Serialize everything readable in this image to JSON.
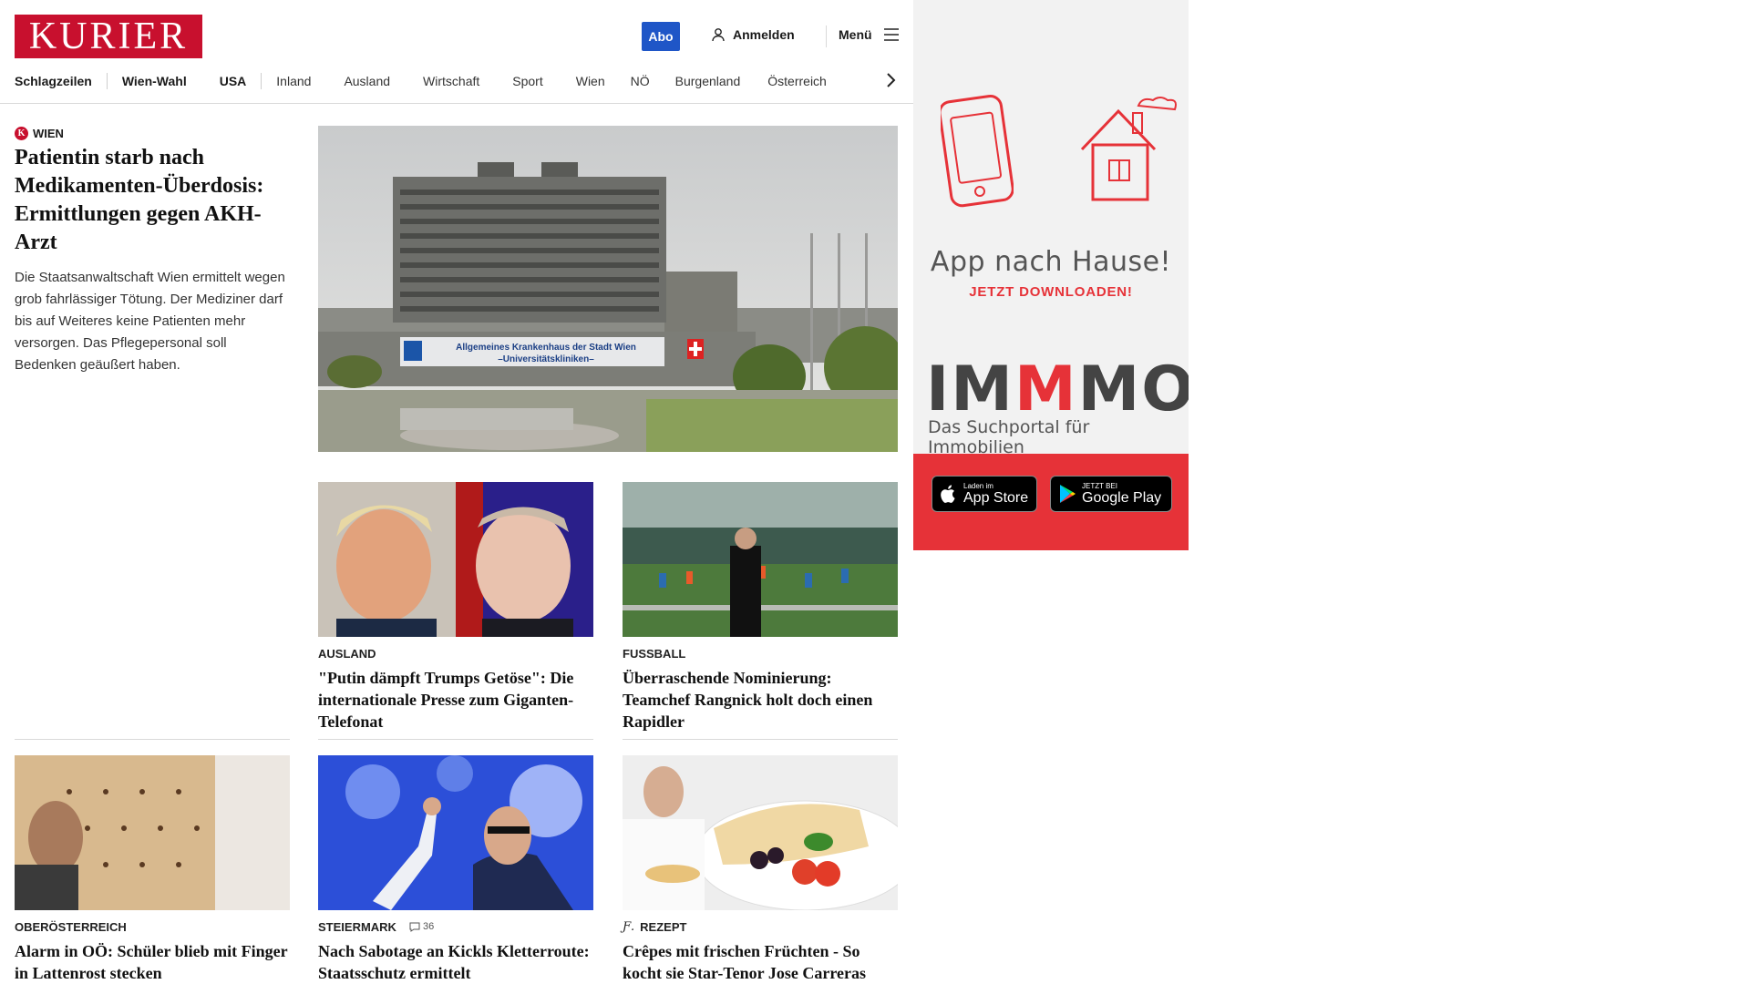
{
  "brand": {
    "name": "KURIER",
    "color": "#c8102e"
  },
  "header": {
    "abo_label": "Abo",
    "login_label": "Anmelden",
    "menu_label": "Menü"
  },
  "nav": {
    "items": [
      "Schlagzeilen",
      "Wien-Wahl",
      "USA",
      "Inland",
      "Ausland",
      "Wirtschaft",
      "Sport",
      "Wien",
      "NÖ",
      "Burgenland",
      "Österreich"
    ]
  },
  "lead": {
    "kicker": "WIEN",
    "badge": "K",
    "title": "Patientin starb nach Medikamenten-Überdosis: Ermittlungen gegen AKH-Arzt",
    "text": "Die Staatsanwaltschaft Wien ermittelt wegen grob fahrlässiger Tötung. Der Mediziner darf bis auf Weiteres keine Patienten mehr versorgen. Das Pflegepersonal soll Bedenken geäußert haben.",
    "image_sign": [
      "Allgemeines Krankenhaus der Stadt Wien",
      "–Universitätskliniken–"
    ]
  },
  "cards": [
    {
      "kicker": "AUSLAND",
      "title": "\"Putin dämpft Trumps Getöse\": Die internationale Presse zum Giganten-Telefonat"
    },
    {
      "kicker": "FUSSBALL",
      "title": "Überraschende Nominierung: Teamchef Rangnick holt doch einen Rapidler"
    },
    {
      "kicker": "OBERÖSTERREICH",
      "title": "Alarm in OÖ: Schüler blieb mit Finger in Lattenrost stecken"
    },
    {
      "kicker": "STEIERMARK",
      "comments": "36",
      "title": "Nach Sabotage an Kickls Kletterroute: Staatsschutz ermittelt"
    },
    {
      "kicker": "REZEPT",
      "title": "Crêpes mit frischen Früchten - So kocht sie Star-Tenor Jose Carreras"
    }
  ],
  "ad": {
    "title": "App nach Hause!",
    "subtitle": "JETZT DOWNLOADEN!",
    "brand_parts": [
      "IM",
      "M",
      "MO"
    ],
    "tagline": "Das Suchportal für Immobilien",
    "appstore_small": "Laden im",
    "appstore_big": "App Store",
    "googleplay_small": "JETZT BEI",
    "googleplay_big": "Google Play",
    "accent": "#e63238"
  }
}
